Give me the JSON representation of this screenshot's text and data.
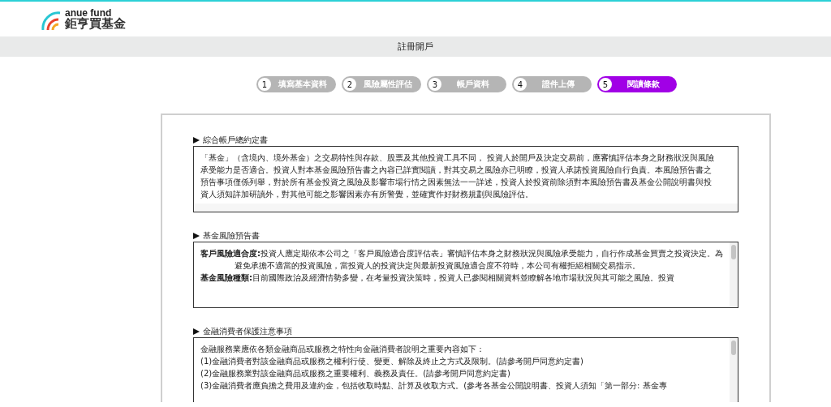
{
  "header": {
    "logo_word": "anue fund",
    "logo_name": "鉅亨買基金"
  },
  "title_bar": {
    "title": "註冊開戶"
  },
  "steps": [
    {
      "number": "1",
      "label": "填寫基本資料",
      "selected": false
    },
    {
      "number": "2",
      "label": "風險屬性評估",
      "selected": false
    },
    {
      "number": "3",
      "label": "帳戶資料",
      "selected": false
    },
    {
      "number": "4",
      "label": "證件上傳",
      "selected": false
    },
    {
      "number": "5",
      "label": "閱讀條款",
      "selected": true
    }
  ],
  "sections": [
    {
      "kind": "plain",
      "heading": "綜合帳戶總約定書",
      "scrollbar": false,
      "paragraphs": [
        "「基金」（含境內、境外基金）之交易特性與存款、股票及其他投資工具不同， 投資人於開戶及決定交易前，應審慎評估本身之財務狀況與風險承受能力是否適合。投資人對本基金風險預告書之內容已詳實閱讀，對其交易之風險亦已明瞭，投資人承諾投資風險自行負責。本風險預告書之預告事項僅係列舉，對於所有基金投資之風險及影響市場行情之因素無法一一詳述，投資人於投資前除須對本風險預告書及基金公開說明書與投資人須知詳加研讀外，對其他可能之影響因素亦有所警覺，並確實作好財務規劃與風險評估。"
      ]
    },
    {
      "kind": "terms",
      "heading": "基金風險預告書",
      "scrollbar": true,
      "paragraphs": [
        "**客戶風險適合度:**投資人應定期依本公司之「客戶風險適合度評估表」審慎評估本身之財務狀況與風險承受能力，自行作成基金買賣之投資決定。為避免承擔不適當的投資風險，當投資人的投資決定與最新投資風險適合度不符時，本公司有權拒絕相關交易指示。",
        "**基金風險種類:**目前國際政治及經濟情勢多變，在考量投資決策時，投資人已參閱相關資料並瞭解各地市場狀況與其可能之風險。投資"
      ]
    },
    {
      "kind": "lines",
      "heading": "金融消費者保護注意事項",
      "scrollbar": true,
      "paragraphs": [
        "金融服務業應依各類金融商品或服務之特性向金融消費者說明之重要內容如下：",
        "(1)金融消費者對該金融商品或服務之權利行使、變更、解除及終止之方式及限制。(請參考開戶同意約定書)",
        "(2)金融服務業對該金融商品或服務之重要權利、義務及責任。(請參考開戶同意約定書)",
        "(3)金融消費者應負擔之費用及違約金，包括收取時點、計算及收取方式。(參考各基金公開說明書、投資人須知「第一部分: 基金專"
      ]
    }
  ]
}
